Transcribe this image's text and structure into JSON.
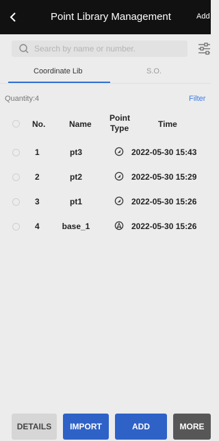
{
  "header": {
    "title": "Point Library Management",
    "add_label": "Add"
  },
  "search": {
    "placeholder": "Search by name or number.",
    "value": ""
  },
  "tabs": [
    {
      "label": "Coordinate Lib",
      "active": true
    },
    {
      "label": "S.O.",
      "active": false
    }
  ],
  "summary": {
    "quantity_label": "Quantity:4",
    "filter_label": "Filter"
  },
  "table": {
    "columns": [
      "No.",
      "Name",
      "Point Type",
      "Time"
    ],
    "point_type_header_line1": "Point",
    "point_type_header_line2": "Type",
    "rows": [
      {
        "no": "1",
        "name": "pt3",
        "type_icon": "survey-point-icon",
        "time": "2022-05-30 15:43"
      },
      {
        "no": "2",
        "name": "pt2",
        "type_icon": "survey-point-icon",
        "time": "2022-05-30 15:29"
      },
      {
        "no": "3",
        "name": "pt1",
        "type_icon": "survey-point-icon",
        "time": "2022-05-30 15:26"
      },
      {
        "no": "4",
        "name": "base_1",
        "type_icon": "base-station-icon",
        "time": "2022-05-30 15:26"
      }
    ]
  },
  "buttons": {
    "details": "DETAILS",
    "import": "IMPORT",
    "add": "ADD",
    "more": "MORE"
  },
  "colors": {
    "accent": "#2f62c7",
    "tab_underline": "#2f6fd1",
    "filter_link": "#3b7be0",
    "more_button": "#575757",
    "details_button": "#d6d6d6",
    "topbar": "#111111"
  }
}
